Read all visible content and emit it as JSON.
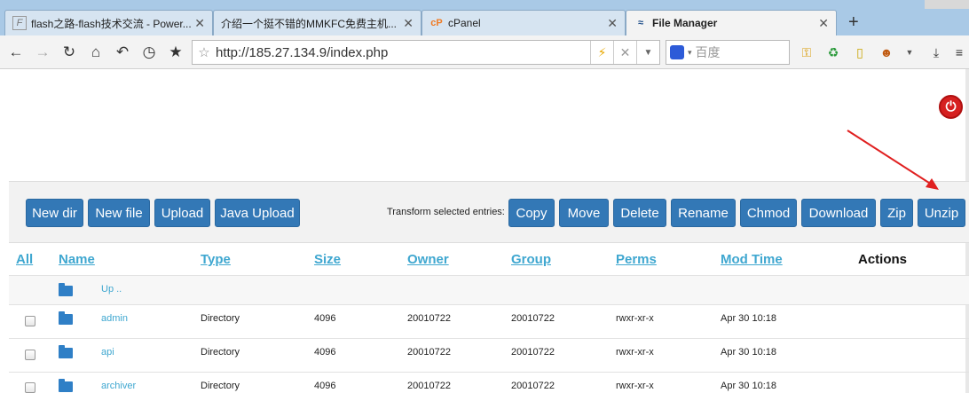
{
  "browser": {
    "tabs": [
      {
        "title": "flash之路-flash技术交流 - Power...",
        "favicon": "F"
      },
      {
        "title": "介绍一个挺不错的MMKFC免费主机...",
        "favicon": ""
      },
      {
        "title": "cPanel",
        "favicon": "cP"
      },
      {
        "title": "File Manager",
        "favicon": "≈"
      }
    ],
    "new_tab": "+",
    "url": "http://185.27.134.9/index.php",
    "search_placeholder": "百度",
    "icons": [
      "back-icon",
      "forward-icon",
      "reload-icon",
      "home-icon",
      "undo-icon",
      "history-icon",
      "bookmark-star-icon"
    ]
  },
  "toolbar": {
    "left_buttons": [
      "New dir",
      "New file",
      "Upload",
      "Java Upload"
    ],
    "transform_label": "Transform selected entries:",
    "right_buttons": [
      "Copy",
      "Move",
      "Delete",
      "Rename",
      "Chmod",
      "Download",
      "Zip",
      "Unzip"
    ]
  },
  "table": {
    "headers": {
      "all": "All",
      "name": "Name",
      "type": "Type",
      "size": "Size",
      "owner": "Owner",
      "group": "Group",
      "perms": "Perms",
      "mod_time": "Mod Time",
      "actions": "Actions"
    },
    "up_label": "Up ..",
    "rows": [
      {
        "name": "admin",
        "type": "Directory",
        "size": "4096",
        "owner": "20010722",
        "group": "20010722",
        "perms": "rwxr-xr-x",
        "mod_time": "Apr 30 10:18"
      },
      {
        "name": "api",
        "type": "Directory",
        "size": "4096",
        "owner": "20010722",
        "group": "20010722",
        "perms": "rwxr-xr-x",
        "mod_time": "Apr 30 10:18"
      },
      {
        "name": "archiver",
        "type": "Directory",
        "size": "4096",
        "owner": "20010722",
        "group": "20010722",
        "perms": "rwxr-xr-x",
        "mod_time": "Apr 30 10:18"
      }
    ]
  },
  "colors": {
    "button": "#3378b6",
    "link": "#3fa7d0",
    "arrow": "#e02020",
    "power": "#d62020"
  }
}
